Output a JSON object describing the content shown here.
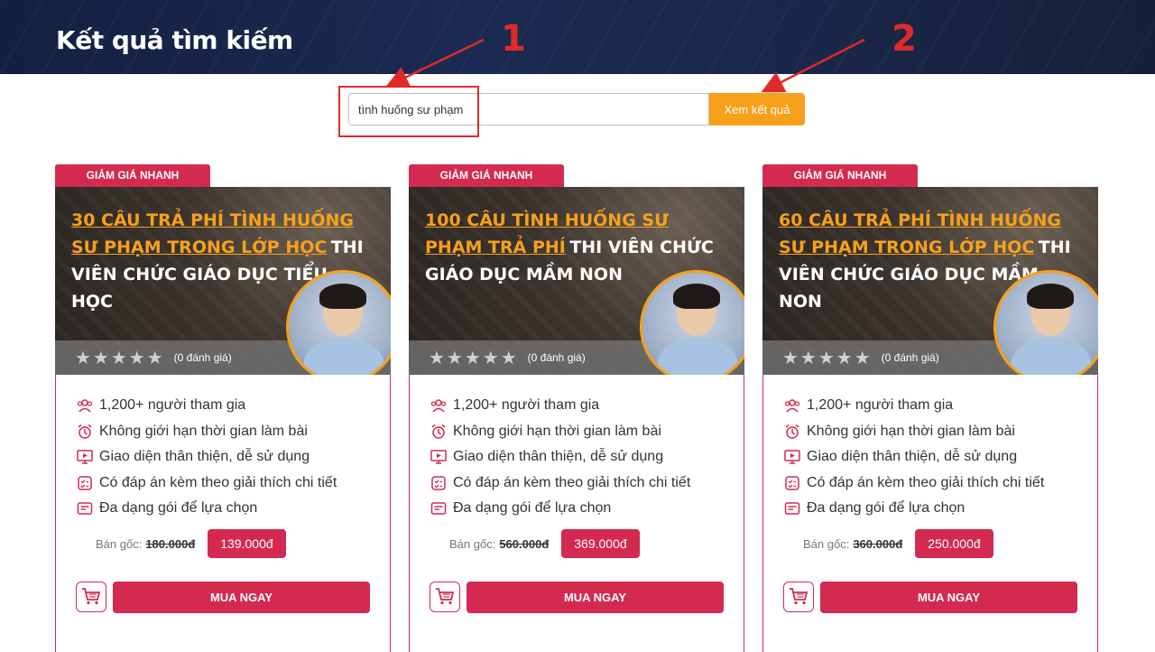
{
  "header": {
    "title": "Kết quả tìm kiếm"
  },
  "annotations": {
    "marker_1": "1",
    "marker_2": "2"
  },
  "search": {
    "value": "tình huống sư phạm",
    "button_label": "Xem kết quả"
  },
  "colors": {
    "accent": "#d42a4f",
    "orange": "#f7a01b",
    "annotation": "#e02a2a",
    "header_bg": "#1b2a52"
  },
  "card_common": {
    "tag": "GIẢM GIÁ NHANH",
    "stars_empty": "★★★★★",
    "rating_count": "(0 đánh giá)",
    "features": [
      {
        "icon": "users-icon",
        "text": "1,200+ người tham gia"
      },
      {
        "icon": "alarm-clock-icon",
        "text": "Không giới hạn thời gian làm bài"
      },
      {
        "icon": "monitor-icon",
        "text": "Giao diện thân thiện, dễ sử dụng"
      },
      {
        "icon": "checklist-icon",
        "text": "Có đáp án kèm theo giải thích chi tiết"
      },
      {
        "icon": "package-icon",
        "text": "Đa dạng gói để lựa chọn"
      }
    ],
    "price_label": "Bán gốc:",
    "buy_label": "MUA NGAY"
  },
  "cards": [
    {
      "headline_orange": "30 CÂU TRẢ PHÍ TÌNH HUỐNG SƯ PHẠM TRONG LỚP HỌC",
      "headline_white": "THI VIÊN CHỨC GIÁO DỤC TIỂU HỌC",
      "price_old": "180.000đ",
      "price_new": "139.000đ"
    },
    {
      "headline_orange": "100 CÂU TÌNH HUỐNG SƯ PHẠM TRẢ PHÍ",
      "headline_white": "THI VIÊN CHỨC GIÁO DỤC MẦM NON",
      "price_old": "560.000đ",
      "price_new": "369.000đ"
    },
    {
      "headline_orange": "60 CÂU TRẢ PHÍ TÌNH HUỐNG SƯ PHẠM TRONG LỚP HỌC",
      "headline_white": "THI VIÊN CHỨC GIÁO DỤC MẦM NON",
      "price_old": "360.000đ",
      "price_new": "250.000đ"
    }
  ]
}
